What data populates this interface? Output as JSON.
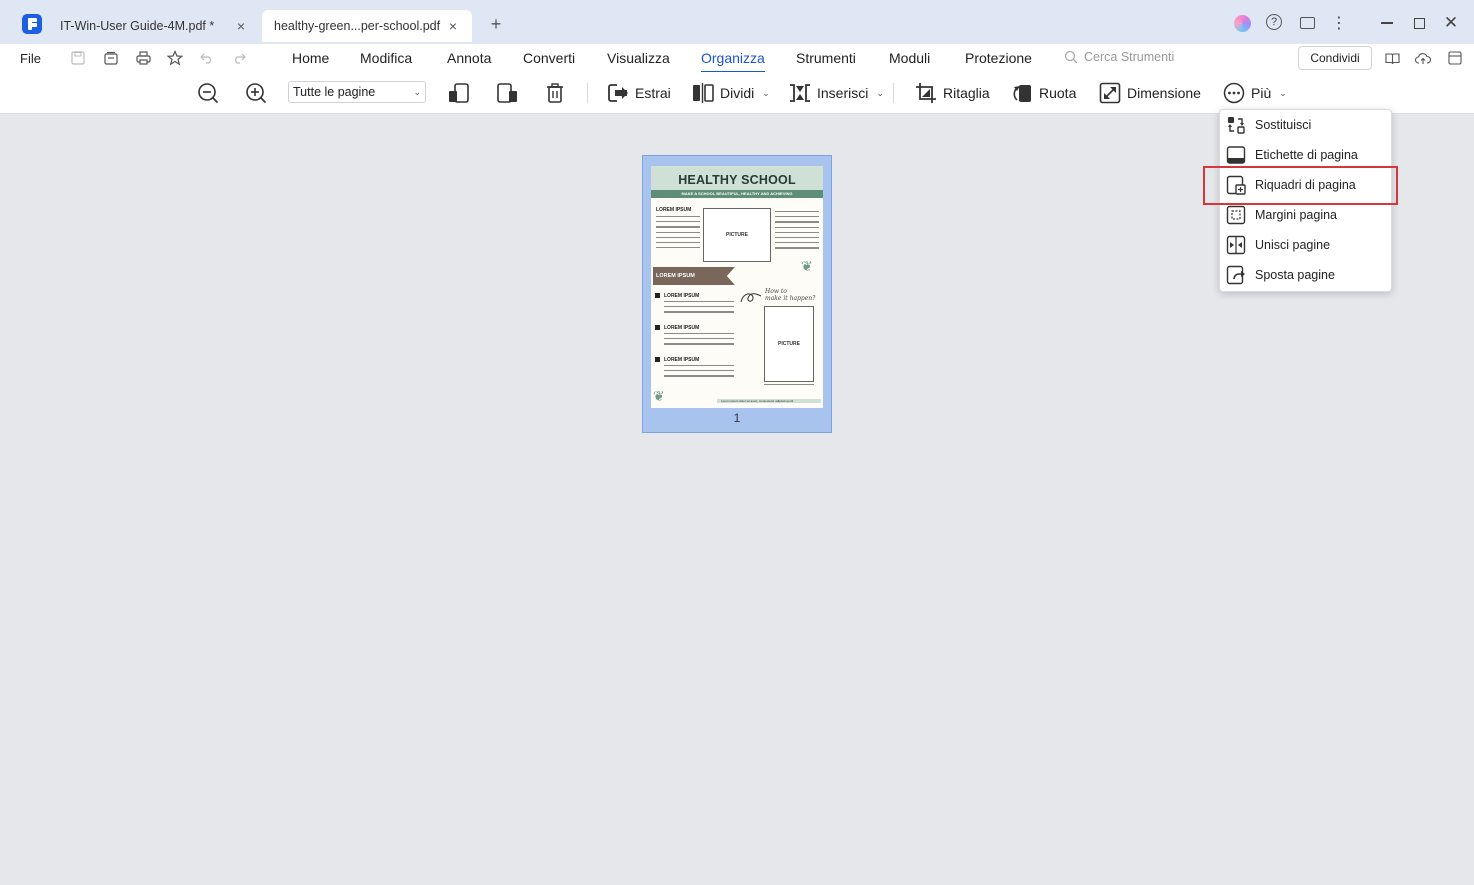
{
  "tabs": [
    {
      "label": "IT-Win-User Guide-4M.pdf *",
      "close": "×"
    },
    {
      "label": "healthy-green...per-school.pdf",
      "close": "×"
    }
  ],
  "tab_add": "+",
  "window": {
    "help": "?",
    "more": "⋮",
    "close": "✕"
  },
  "menubar": {
    "file": "File",
    "tabs": [
      "Home",
      "Modifica",
      "Annota",
      "Converti",
      "Visualizza",
      "Organizza",
      "Strumenti",
      "Moduli",
      "Protezione"
    ],
    "active_tab": "Organizza",
    "search_placeholder": "Cerca Strumenti",
    "share_label": "Condividi"
  },
  "toolbar": {
    "page_range": "Tutte le pagine",
    "extract": "Estrai",
    "split": "Dividi",
    "insert": "Inserisci",
    "crop": "Ritaglia",
    "rotate": "Ruota",
    "size": "Dimensione",
    "more": "Più"
  },
  "more_menu": {
    "items": [
      "Sostituisci",
      "Etichette di pagina",
      "Riquadri di pagina",
      "Margini pagina",
      "Unisci pagine",
      "Sposta pagine"
    ],
    "highlighted": "Riquadri di pagina"
  },
  "page_thumbnail": {
    "page_number": "1",
    "title": "HEALTHY SCHOOL",
    "subtitle": "MAKE A SCHOOL BEAUTIFUL, HEALTHY AND ACHIEVING",
    "heading": "LOREM IPSUM",
    "picture_label": "PICTURE",
    "ribbon_label": "LOREM IPSUM",
    "bullet_heading": "LOREM IPSUM",
    "script_text_1": "How to",
    "script_text_2": "make it happen?",
    "footer_text": "Lorem ipsum dolor sit amet, consectetur adipiscing elit"
  },
  "colors": {
    "accent": "#1a55d6",
    "tab_bar": "#dfe7f4",
    "canvas": "#e5e7ea",
    "highlight_box": "#d6343f",
    "thumb_selection": "#a9c3ef"
  }
}
